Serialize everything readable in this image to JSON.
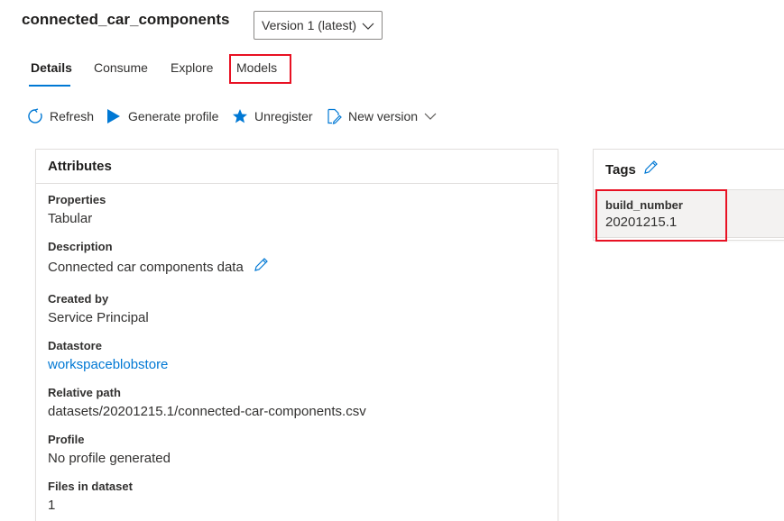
{
  "header": {
    "title": "connected_car_components",
    "version_select": {
      "selected": "Version 1 (latest)"
    }
  },
  "tabs": [
    {
      "label": "Details",
      "active": true
    },
    {
      "label": "Consume",
      "active": false
    },
    {
      "label": "Explore",
      "active": false
    },
    {
      "label": "Models",
      "active": false
    }
  ],
  "toolbar": {
    "refresh": "Refresh",
    "generate_profile": "Generate profile",
    "unregister": "Unregister",
    "new_version": "New version"
  },
  "attributes": {
    "heading": "Attributes",
    "items": [
      {
        "label": "Properties",
        "value": "Tabular"
      },
      {
        "label": "Description",
        "value": "Connected car components data"
      },
      {
        "label": "Created by",
        "value": "Service Principal"
      },
      {
        "label": "Datastore",
        "value": "workspaceblobstore"
      },
      {
        "label": "Relative path",
        "value": "datasets/20201215.1/connected-car-components.csv"
      },
      {
        "label": "Profile",
        "value": "No profile generated"
      },
      {
        "label": "Files in dataset",
        "value": "1"
      }
    ]
  },
  "tags": {
    "heading": "Tags",
    "items": [
      {
        "key": "build_number",
        "value": "20201215.1"
      }
    ]
  },
  "colors": {
    "accent": "#0078d4",
    "highlight": "#e81123",
    "text": "#323130"
  }
}
